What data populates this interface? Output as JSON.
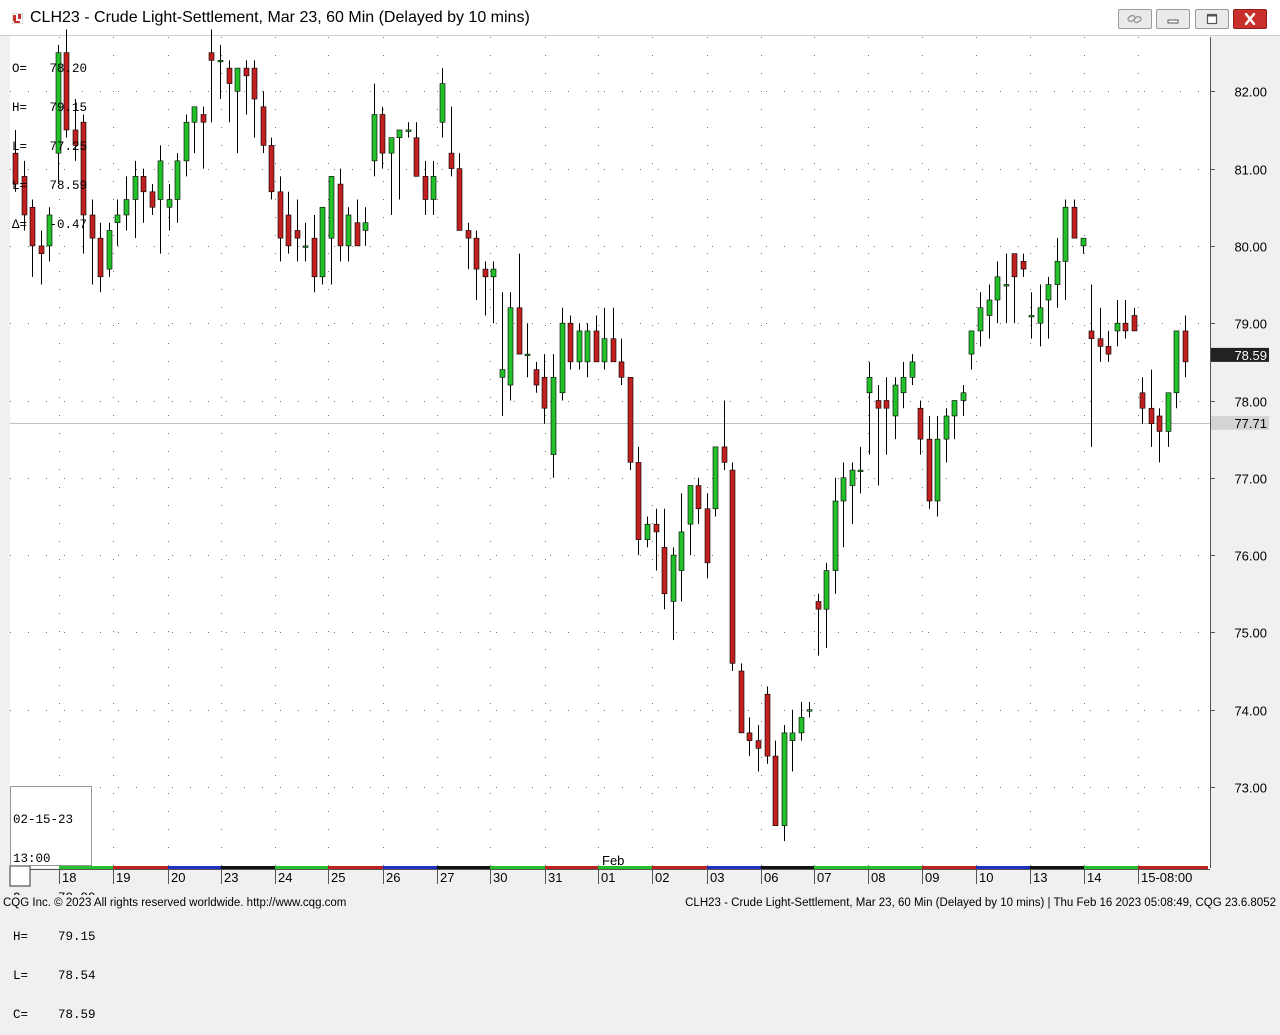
{
  "window": {
    "title": "CLH23 - Crude Light-Settlement, Mar 23, 60 Min (Delayed by 10 mins)",
    "buttons": [
      "link-icon",
      "minimize-icon",
      "maximize-icon",
      "close-icon"
    ]
  },
  "ohlc_top": {
    "lines": [
      "O=   78.20",
      "H=   79.15",
      "L=   77.25",
      "L=   78.59",
      "Δ=   -0.47"
    ]
  },
  "ohlc_bottom": {
    "date": "02-15-23",
    "time": "13:00",
    "lines": [
      "O=    78.99",
      "H=    79.15",
      "L=    78.54",
      "C=    78.59"
    ]
  },
  "status": {
    "left": "CQG Inc. © 2023 All rights reserved worldwide. http://www.cqg.com",
    "right": "CLH23 - Crude Light-Settlement, Mar 23, 60 Min (Delayed by 10 mins) | Thu Feb 16 2023 05:08:49, CQG 23.6.8052"
  },
  "colors": {
    "up": "#22c02a",
    "down": "#c02020",
    "title_icon": "#c8312b",
    "last_price_bg": "#222222",
    "ref_price_bg": "#d4d4d4",
    "ref_line": "#c0c0c0"
  },
  "chart_data": {
    "type": "candlestick",
    "symbol": "CLH23",
    "interval": "60 Min",
    "ylim": [
      72.3,
      83.0
    ],
    "yticks": [
      "73.00",
      "74.00",
      "75.00",
      "76.00",
      "77.00",
      "78.00",
      "79.00",
      "80.00",
      "81.00",
      "82.00"
    ],
    "last_price": "78.59",
    "reference_price": "77.71",
    "month_label": "Feb",
    "date_labels": [
      "18",
      "19",
      "20",
      "23",
      "24",
      "25",
      "26",
      "27",
      "30",
      "31",
      "01",
      "02",
      "03",
      "06",
      "07",
      "08",
      "09",
      "10",
      "13",
      "14",
      "15-08:00"
    ],
    "grid": true,
    "candles": [
      [
        81.2,
        81.5,
        80.7,
        80.8
      ],
      [
        80.9,
        81.1,
        80.2,
        80.4
      ],
      [
        80.5,
        80.6,
        79.6,
        80.0
      ],
      [
        80.0,
        80.2,
        79.5,
        79.9
      ],
      [
        80.0,
        80.5,
        79.8,
        80.4
      ],
      [
        81.2,
        82.6,
        80.8,
        82.5
      ],
      [
        82.5,
        82.8,
        81.4,
        81.5
      ],
      [
        81.5,
        81.9,
        81.1,
        81.3
      ],
      [
        81.6,
        81.7,
        79.9,
        80.4
      ],
      [
        80.4,
        80.6,
        79.5,
        80.1
      ],
      [
        80.1,
        80.3,
        79.4,
        79.6
      ],
      [
        79.7,
        80.3,
        79.6,
        80.2
      ],
      [
        80.3,
        80.6,
        80.0,
        80.4
      ],
      [
        80.4,
        80.9,
        80.2,
        80.6
      ],
      [
        80.6,
        81.1,
        80.1,
        80.9
      ],
      [
        80.9,
        81.0,
        80.3,
        80.7
      ],
      [
        80.7,
        80.8,
        80.4,
        80.5
      ],
      [
        80.6,
        81.3,
        79.9,
        81.1
      ],
      [
        80.5,
        80.8,
        80.2,
        80.6
      ],
      [
        80.6,
        81.2,
        80.3,
        81.1
      ],
      [
        81.1,
        81.7,
        80.9,
        81.6
      ],
      [
        81.6,
        81.8,
        81.2,
        81.8
      ],
      [
        81.7,
        81.8,
        81.0,
        81.6
      ],
      [
        82.5,
        82.8,
        81.6,
        82.4
      ],
      [
        82.4,
        82.6,
        81.9,
        82.4
      ],
      [
        82.3,
        82.4,
        81.6,
        82.1
      ],
      [
        82.0,
        82.2,
        81.2,
        82.3
      ],
      [
        82.3,
        82.4,
        81.7,
        82.2
      ],
      [
        82.3,
        82.4,
        81.4,
        81.9
      ],
      [
        81.8,
        82.0,
        81.2,
        81.3
      ],
      [
        81.3,
        81.4,
        80.6,
        80.7
      ],
      [
        80.7,
        80.9,
        79.8,
        80.1
      ],
      [
        80.4,
        80.7,
        79.9,
        80.0
      ],
      [
        80.2,
        80.6,
        79.8,
        80.1
      ],
      [
        80.0,
        80.3,
        79.8,
        80.0
      ],
      [
        80.1,
        80.4,
        79.4,
        79.6
      ],
      [
        79.6,
        80.3,
        79.5,
        80.5
      ],
      [
        80.1,
        80.9,
        79.5,
        80.9
      ],
      [
        80.8,
        81.0,
        79.8,
        80.0
      ],
      [
        80.0,
        80.5,
        79.8,
        80.4
      ],
      [
        80.3,
        80.6,
        80.0,
        80.0
      ],
      [
        80.2,
        80.5,
        80.0,
        80.3
      ],
      [
        81.1,
        82.1,
        80.9,
        81.7
      ],
      [
        81.7,
        81.8,
        81.0,
        81.2
      ],
      [
        81.2,
        81.4,
        80.4,
        81.4
      ],
      [
        81.4,
        81.5,
        80.6,
        81.5
      ],
      [
        81.5,
        81.6,
        81.4,
        81.5
      ],
      [
        81.4,
        81.6,
        80.9,
        80.9
      ],
      [
        80.9,
        81.1,
        80.4,
        80.6
      ],
      [
        80.6,
        81.1,
        80.4,
        80.9
      ],
      [
        81.6,
        82.3,
        81.4,
        82.1
      ],
      [
        81.2,
        81.8,
        80.9,
        81.0
      ],
      [
        81.0,
        81.2,
        80.3,
        80.2
      ],
      [
        80.2,
        80.3,
        79.7,
        80.1
      ],
      [
        80.1,
        80.2,
        79.3,
        79.7
      ],
      [
        79.7,
        79.8,
        79.1,
        79.6
      ],
      [
        79.6,
        79.8,
        79.0,
        79.7
      ],
      [
        78.3,
        79.4,
        77.8,
        78.4
      ],
      [
        78.2,
        79.4,
        78.0,
        79.2
      ],
      [
        79.2,
        79.9,
        78.6,
        78.6
      ],
      [
        78.6,
        79.0,
        78.3,
        78.6
      ],
      [
        78.4,
        78.5,
        78.1,
        78.2
      ],
      [
        78.3,
        78.6,
        77.7,
        77.9
      ],
      [
        77.3,
        78.6,
        77.0,
        78.3
      ],
      [
        78.1,
        79.2,
        78.0,
        79.0
      ],
      [
        79.0,
        79.1,
        78.4,
        78.5
      ],
      [
        78.5,
        79.0,
        78.4,
        78.9
      ],
      [
        78.5,
        79.0,
        78.3,
        78.9
      ],
      [
        78.9,
        79.1,
        78.5,
        78.5
      ],
      [
        78.5,
        79.2,
        78.4,
        78.8
      ],
      [
        78.8,
        79.2,
        78.5,
        78.5
      ],
      [
        78.5,
        78.8,
        78.2,
        78.3
      ],
      [
        78.3,
        78.3,
        77.1,
        77.2
      ],
      [
        77.2,
        77.4,
        76.0,
        76.2
      ],
      [
        76.2,
        76.5,
        76.1,
        76.4
      ],
      [
        76.4,
        76.6,
        75.8,
        76.3
      ],
      [
        76.1,
        76.6,
        75.3,
        75.5
      ],
      [
        75.4,
        76.1,
        74.9,
        76.0
      ],
      [
        75.8,
        76.8,
        75.4,
        76.3
      ],
      [
        76.4,
        76.9,
        76.0,
        76.9
      ],
      [
        76.9,
        77.0,
        76.4,
        76.6
      ],
      [
        76.6,
        76.8,
        75.7,
        75.9
      ],
      [
        76.6,
        77.4,
        76.5,
        77.4
      ],
      [
        77.4,
        78.0,
        77.1,
        77.2
      ],
      [
        77.1,
        77.2,
        74.5,
        74.6
      ],
      [
        74.5,
        74.6,
        73.7,
        73.7
      ],
      [
        73.7,
        73.9,
        73.4,
        73.6
      ],
      [
        73.6,
        73.8,
        73.2,
        73.5
      ],
      [
        74.2,
        74.3,
        73.3,
        73.4
      ],
      [
        73.4,
        73.6,
        72.5,
        72.5
      ],
      [
        72.5,
        73.8,
        72.3,
        73.7
      ],
      [
        73.6,
        74.0,
        73.2,
        73.7
      ],
      [
        73.7,
        74.1,
        73.6,
        73.9
      ],
      [
        74.0,
        74.1,
        73.9,
        74.0
      ],
      [
        75.4,
        75.5,
        74.7,
        75.3
      ],
      [
        75.3,
        75.9,
        74.8,
        75.8
      ],
      [
        75.8,
        77.0,
        75.5,
        76.7
      ],
      [
        76.7,
        77.2,
        76.1,
        77.0
      ],
      [
        76.9,
        77.2,
        76.4,
        77.1
      ],
      [
        77.1,
        77.4,
        76.8,
        77.1
      ],
      [
        78.1,
        78.5,
        77.3,
        78.3
      ],
      [
        78.0,
        78.2,
        76.9,
        77.9
      ],
      [
        78.0,
        78.3,
        77.3,
        77.9
      ],
      [
        77.8,
        78.3,
        77.5,
        78.2
      ],
      [
        78.1,
        78.5,
        77.9,
        78.3
      ],
      [
        78.3,
        78.6,
        78.2,
        78.5
      ],
      [
        77.9,
        78.0,
        77.3,
        77.5
      ],
      [
        77.5,
        77.8,
        76.6,
        76.7
      ],
      [
        76.7,
        77.8,
        76.5,
        77.5
      ],
      [
        77.5,
        77.9,
        77.2,
        77.8
      ],
      [
        77.8,
        78.0,
        77.5,
        78.0
      ],
      [
        78.0,
        78.2,
        77.8,
        78.1
      ],
      [
        78.6,
        78.9,
        78.4,
        78.9
      ],
      [
        78.9,
        79.4,
        78.7,
        79.2
      ],
      [
        79.1,
        79.5,
        78.8,
        79.3
      ],
      [
        79.3,
        79.8,
        79.0,
        79.6
      ],
      [
        79.5,
        79.9,
        79.0,
        79.5
      ],
      [
        79.9,
        79.9,
        79.0,
        79.6
      ],
      [
        79.8,
        79.9,
        79.6,
        79.7
      ],
      [
        79.1,
        79.4,
        78.8,
        79.1
      ],
      [
        79.0,
        79.5,
        78.7,
        79.2
      ],
      [
        79.3,
        79.6,
        78.8,
        79.5
      ],
      [
        79.5,
        80.1,
        79.2,
        79.8
      ],
      [
        79.8,
        80.6,
        79.3,
        80.5
      ],
      [
        80.5,
        80.6,
        80.1,
        80.1
      ],
      [
        80.0,
        80.1,
        79.9,
        80.1
      ],
      [
        78.9,
        79.5,
        77.4,
        78.8
      ],
      [
        78.8,
        79.2,
        78.5,
        78.7
      ],
      [
        78.7,
        78.9,
        78.5,
        78.6
      ],
      [
        78.9,
        79.3,
        78.7,
        79.0
      ],
      [
        79.0,
        79.3,
        78.8,
        78.9
      ],
      [
        79.1,
        79.2,
        78.9,
        78.9
      ],
      [
        78.1,
        78.3,
        77.7,
        77.9
      ],
      [
        77.9,
        78.4,
        77.4,
        77.7
      ],
      [
        77.8,
        77.9,
        77.2,
        77.6
      ],
      [
        77.6,
        78.1,
        77.4,
        78.1
      ],
      [
        78.1,
        78.2,
        77.9,
        78.9
      ],
      [
        78.9,
        79.1,
        78.3,
        78.5
      ]
    ]
  }
}
